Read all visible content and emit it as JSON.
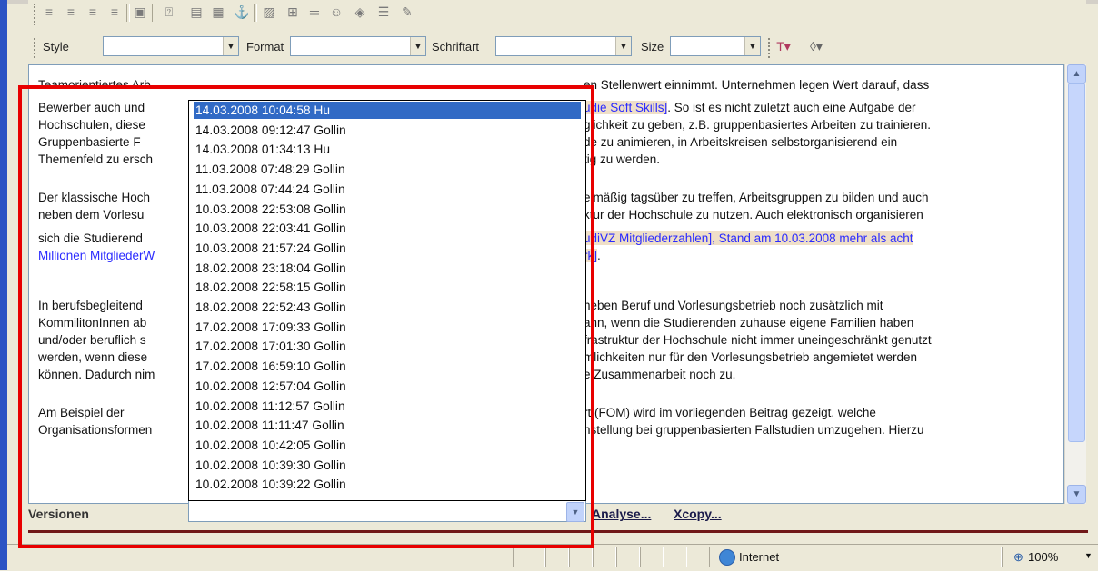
{
  "toolbar": {
    "style_label": "Style",
    "format_label": "Format",
    "font_label": "Schriftart",
    "size_label": "Size",
    "style_value": "",
    "format_value": "",
    "font_value": "",
    "size_value": ""
  },
  "editor": {
    "lines": [
      {
        "left": "Teamorientiertes Arb",
        "right": "en Stellenwert einnimmt. Unternehmen legen Wert darauf, dass"
      },
      {
        "left": "Bewerber auch und",
        "right_link": "udie Soft Skills]",
        "right": ". So ist es nicht zuletzt auch eine Aufgabe der"
      },
      {
        "left": "Hochschulen, diese",
        "right": "glichkeit zu geben, z.B. gruppenbasiertes Arbeiten zu trainieren."
      },
      {
        "left": "Gruppenbasierte F",
        "right": "de zu animieren, in Arbeitskreisen selbstorganisierend ein"
      },
      {
        "left": "Themenfeld zu ersch",
        "right": "tig zu werden."
      },
      {
        "left": "Der klassische Hoch",
        "right": "elmäßig tagsüber zu treffen, Arbeitsgruppen zu bilden und auch"
      },
      {
        "left": "neben dem Vorlesu",
        "right": "ktur der Hochschule zu nutzen. Auch elektronisch organisieren"
      },
      {
        "left": "sich die Studierend",
        "right_link": "udiVZ Mitgliederzahlen], Stand am 10.03.2008 mehr als acht"
      },
      {
        "left_link": "Millionen MitgliederW",
        "right_link": "rk]",
        "right": "."
      },
      {
        "left": "In berufsbegleitend",
        "right": "neben Beruf und Vorlesungsbetrieb noch zusätzlich mit"
      },
      {
        "left": "KommilitonInnen ab",
        "right": "ann, wenn die Studierenden zuhause eigene Familien haben"
      },
      {
        "left": "und/oder beruflich s",
        "right": "frastruktur der Hochschule nicht immer uneingeschränkt genutzt"
      },
      {
        "left": "werden, wenn diese",
        "right": "mlichkeiten nur für den Vorlesungsbetrieb angemietet werden"
      },
      {
        "left": "können. Dadurch nim",
        "right": "e Zusammenarbeit noch zu."
      },
      {
        "left": "Am Beispiel der",
        "right": "rt (FOM) wird im vorliegenden Beitrag gezeigt, welche"
      },
      {
        "left": "Organisationsformen",
        "right": "nstellung bei gruppenbasierten Fallstudien umzugehen. Hierzu"
      }
    ]
  },
  "versions": {
    "label": "Versionen",
    "analyse_link": "Analyse...",
    "xcopy_link": "Xcopy...",
    "selected_value": "",
    "items": [
      "14.03.2008 10:04:58 Hu",
      "14.03.2008 09:12:47 Gollin",
      "14.03.2008 01:34:13 Hu",
      "11.03.2008 07:48:29 Gollin",
      "11.03.2008 07:44:24 Gollin",
      "10.03.2008 22:53:08 Gollin",
      "10.03.2008 22:03:41 Gollin",
      "10.03.2008 21:57:24 Gollin",
      "18.02.2008 23:18:04 Gollin",
      "18.02.2008 22:58:15 Gollin",
      "18.02.2008 22:52:43 Gollin",
      "17.02.2008 17:09:33 Gollin",
      "17.02.2008 17:01:30 Gollin",
      "17.02.2008 16:59:10 Gollin",
      "10.02.2008 12:57:04 Gollin",
      "10.02.2008 11:12:57 Gollin",
      "10.02.2008 11:11:47 Gollin",
      "10.02.2008 10:42:05 Gollin",
      "10.02.2008 10:39:30 Gollin",
      "10.02.2008 10:39:22 Gollin"
    ]
  },
  "statusbar": {
    "zone_label": "Internet",
    "zoom_label": "100%"
  },
  "colors": {
    "selection": "#316ac5",
    "link": "#2a2aff",
    "highlight": "#efdfc8",
    "annotation": "#e80000"
  }
}
